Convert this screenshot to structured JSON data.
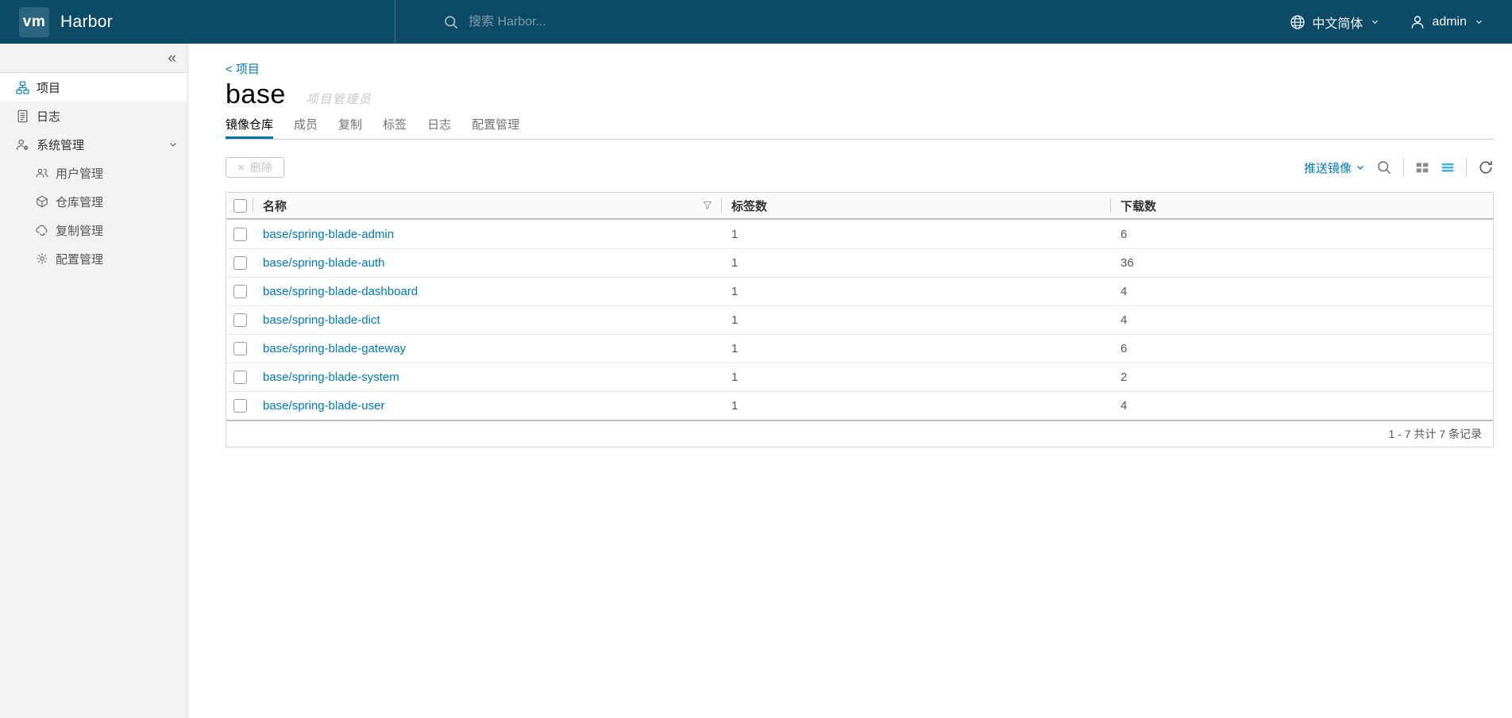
{
  "colors": {
    "accent": "#0079b8",
    "tab_underline": "#0072a3",
    "header_bg": "#0d4a66",
    "header_tile": "#2d6480",
    "sidebar_bg": "#f2f2f2",
    "list_active_blue": "#49afd9"
  },
  "icons": {
    "collapse": "«",
    "close": "×"
  },
  "header": {
    "logo_text": "vm",
    "brand": "Harbor",
    "search_placeholder": "搜索 Harbor...",
    "language": "中文简体",
    "user": "admin"
  },
  "sidebar": {
    "items": [
      {
        "label": "项目",
        "icon": "organization",
        "active": true
      },
      {
        "label": "日志",
        "icon": "log"
      },
      {
        "label": "系统管理",
        "icon": "administrator",
        "expanded": true
      }
    ],
    "subitems": [
      {
        "label": "用户管理",
        "icon": "users"
      },
      {
        "label": "仓库管理",
        "icon": "registry"
      },
      {
        "label": "复制管理",
        "icon": "replication"
      },
      {
        "label": "配置管理",
        "icon": "configuration"
      }
    ]
  },
  "main": {
    "breadcrumb": "< 项目",
    "title": "base",
    "role_badge": "项目管理员",
    "tabs": [
      {
        "label": "镜像仓库",
        "active": true
      },
      {
        "label": "成员"
      },
      {
        "label": "复制"
      },
      {
        "label": "标签"
      },
      {
        "label": "日志"
      },
      {
        "label": "配置管理"
      }
    ],
    "toolbar": {
      "delete_label": "删除",
      "push_image_label": "推送镜像"
    },
    "table": {
      "columns": [
        "名称",
        "标签数",
        "下载数"
      ],
      "rows": [
        {
          "name": "base/spring-blade-admin",
          "tags": "1",
          "pulls": "6"
        },
        {
          "name": "base/spring-blade-auth",
          "tags": "1",
          "pulls": "36"
        },
        {
          "name": "base/spring-blade-dashboard",
          "tags": "1",
          "pulls": "4"
        },
        {
          "name": "base/spring-blade-dict",
          "tags": "1",
          "pulls": "4"
        },
        {
          "name": "base/spring-blade-gateway",
          "tags": "1",
          "pulls": "6"
        },
        {
          "name": "base/spring-blade-system",
          "tags": "1",
          "pulls": "2"
        },
        {
          "name": "base/spring-blade-user",
          "tags": "1",
          "pulls": "4"
        }
      ],
      "footer": "1 - 7 共计 7 条记录"
    }
  }
}
